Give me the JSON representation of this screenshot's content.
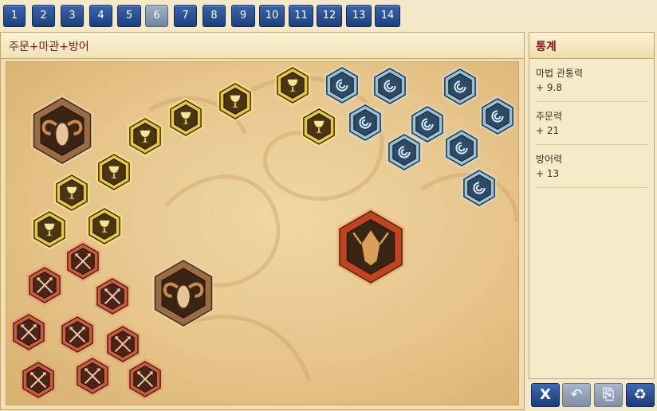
{
  "tabs": [
    "1",
    "2",
    "3",
    "4",
    "5",
    "6",
    "7",
    "8",
    "9",
    "10",
    "11",
    "12",
    "13",
    "14"
  ],
  "active_tab": "6",
  "main_title": "주문+마관+방어",
  "side_title": "통계",
  "stats": [
    {
      "name": "마법 관통력",
      "value": "+ 9.8"
    },
    {
      "name": "주문력",
      "value": "+ 21"
    },
    {
      "name": "방어력",
      "value": "+ 13"
    }
  ],
  "buttons": [
    {
      "name": "reset-button",
      "icon": "close-icon",
      "label": "X",
      "disabled": false
    },
    {
      "name": "undo-button",
      "icon": "undo-icon",
      "label": "↶",
      "disabled": true
    },
    {
      "name": "save-button",
      "icon": "save-icon",
      "label": "⎘",
      "disabled": true
    },
    {
      "name": "recycle-button",
      "icon": "recycle-icon",
      "label": "♻",
      "disabled": false
    }
  ],
  "node_types": {
    "chalice": {
      "color": "#e7c646",
      "glow": "#fff27a",
      "icon": "chalice-icon"
    },
    "seal": {
      "color": "#8ec3e8",
      "glow": "#bfe6ff",
      "icon": "seal-icon"
    },
    "arrows": {
      "color": "#d25a3c",
      "glow": "#ff8a6a",
      "icon": "crossed-arrows-icon"
    },
    "ram": {
      "color": "#9a6b45",
      "glow": "#f3d9b6",
      "icon": "ram-icon"
    },
    "dragon": {
      "color": "#c2431f",
      "glow": "#ff8d4a",
      "icon": "dragon-icon"
    }
  },
  "colors": {
    "tab": "#2b52a0",
    "tab_active": "#8396b0",
    "title": "#6b1f1f"
  }
}
